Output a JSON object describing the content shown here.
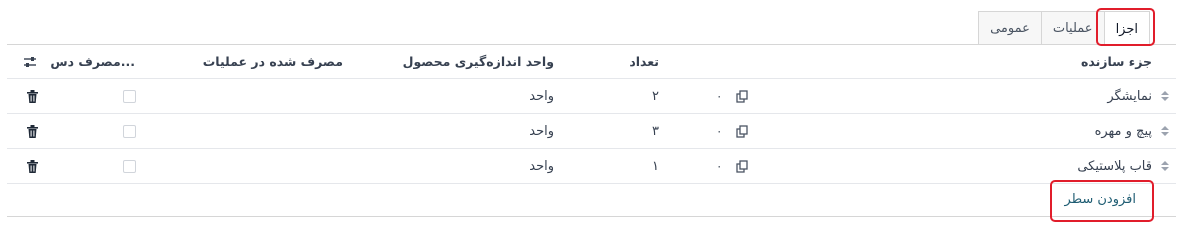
{
  "tabs": [
    {
      "label": "اجزا",
      "active": true
    },
    {
      "label": "عملیات",
      "active": false
    },
    {
      "label": "عمومی",
      "active": false
    }
  ],
  "table": {
    "headers": {
      "component": "جزء سازنده",
      "quantity": "تعداد",
      "uom": "واحد اندازه‌گیری محصول",
      "consumed_in_operation": "مصرف شده در عملیات",
      "manual_consumption": "مصرف دس..."
    },
    "rows": [
      {
        "component": "نمایشگر",
        "zero": "۰",
        "quantity": "۲",
        "uom": "واحد",
        "manual": false
      },
      {
        "component": "پیچ و مهره",
        "zero": "۰",
        "quantity": "۳",
        "uom": "واحد",
        "manual": false
      },
      {
        "component": "قاب پلاستیکی",
        "zero": "۰",
        "quantity": "۱",
        "uom": "واحد",
        "manual": false
      }
    ],
    "add_line_label": "افزودن سطر"
  },
  "icons": {
    "optional_columns": "sliders-icon",
    "drag": "drag-handle-icon",
    "copy": "copy-icon",
    "delete": "trash-icon"
  },
  "colors": {
    "highlight": "#e11d2b",
    "link": "#1f5d73"
  }
}
